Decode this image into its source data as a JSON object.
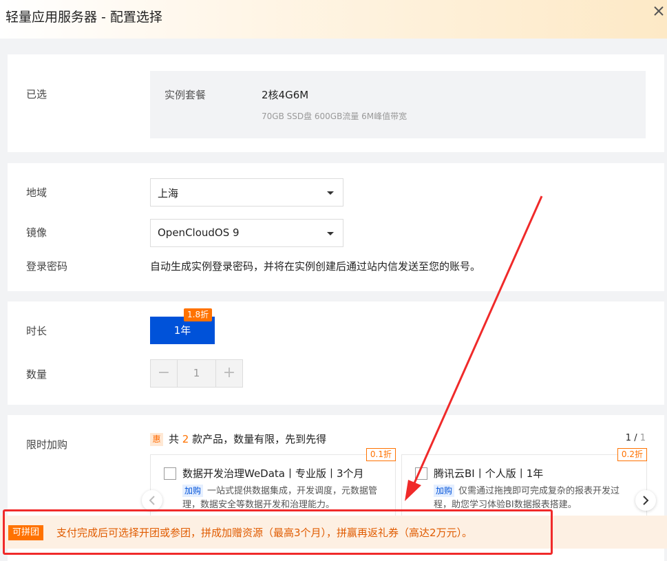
{
  "header": {
    "title": "轻量应用服务器 - 配置选择"
  },
  "selected": {
    "label": "已选",
    "key": "实例套餐",
    "value": "2核4G6M",
    "desc": "70GB SSD盘 600GB流量 6M峰值带宽"
  },
  "region": {
    "label": "地域",
    "value": "上海"
  },
  "image": {
    "label": "镜像",
    "value": "OpenCloudOS 9"
  },
  "password": {
    "label": "登录密码",
    "text": "自动生成实例登录密码，并将在实例创建后通过站内信发送至您的账号。"
  },
  "duration": {
    "label": "时长",
    "option": "1年",
    "discount": "1.8折"
  },
  "quantity": {
    "label": "数量",
    "value": "1",
    "minus": "−",
    "plus": "+"
  },
  "promo": {
    "label": "限时加购",
    "icon_text": "惠",
    "head_prefix": "共",
    "count": "2",
    "head_suffix": "款产品，数量有限，先到先得",
    "page_current": "1",
    "page_sep": "/",
    "page_total": "1",
    "products": [
      {
        "name": "数据开发治理WeData丨专业版丨3个月",
        "discount": "0.1折",
        "tag": "加购",
        "desc": "一站式提供数据集成，开发调度，元数据管理，数据安全等数据开发和治理能力。"
      },
      {
        "name": "腾讯云BI丨个人版丨1年",
        "discount": "0.2折",
        "tag": "加购",
        "desc": "仅需通过拖拽即可完成复杂的报表开发过程，助您学习体验BI数据报表搭建。"
      }
    ]
  },
  "group": {
    "badge": "可拼团",
    "text": "支付完成后可选择开团或参团，拼成加赠资源（最高3个月），拼赢再返礼券（高达2万元）。"
  },
  "colors": {
    "primary": "#0052d9",
    "accent": "#ff7200",
    "annotation": "#f02a2a"
  }
}
